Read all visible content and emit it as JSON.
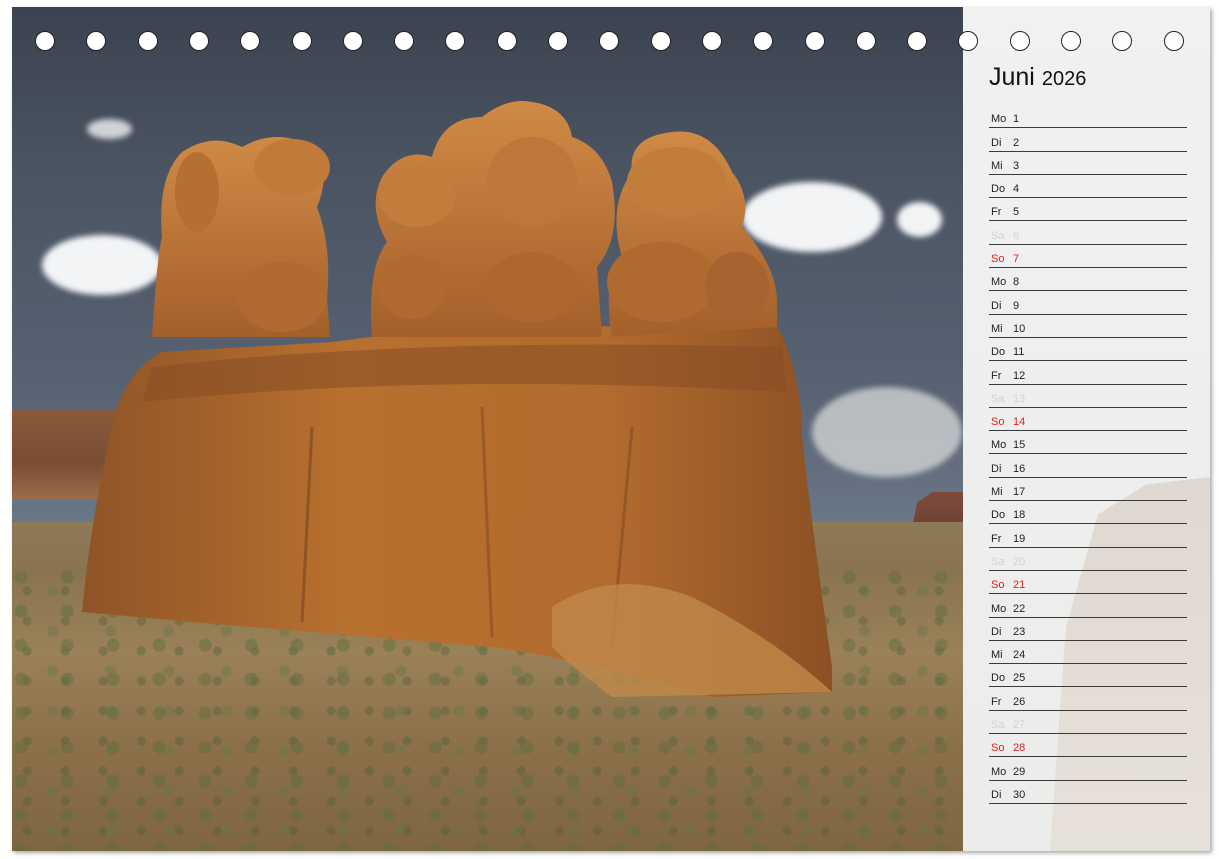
{
  "calendar": {
    "month": "Juni",
    "year": "2026",
    "days": [
      {
        "wd": "Mo",
        "d": "1",
        "type": "weekday"
      },
      {
        "wd": "Di",
        "d": "2",
        "type": "weekday"
      },
      {
        "wd": "Mi",
        "d": "3",
        "type": "weekday"
      },
      {
        "wd": "Do",
        "d": "4",
        "type": "weekday"
      },
      {
        "wd": "Fr",
        "d": "5",
        "type": "weekday"
      },
      {
        "wd": "Sa",
        "d": "6",
        "type": "sat"
      },
      {
        "wd": "So",
        "d": "7",
        "type": "sun"
      },
      {
        "wd": "Mo",
        "d": "8",
        "type": "weekday"
      },
      {
        "wd": "Di",
        "d": "9",
        "type": "weekday"
      },
      {
        "wd": "Mi",
        "d": "10",
        "type": "weekday"
      },
      {
        "wd": "Do",
        "d": "11",
        "type": "weekday"
      },
      {
        "wd": "Fr",
        "d": "12",
        "type": "weekday"
      },
      {
        "wd": "Sa",
        "d": "13",
        "type": "sat"
      },
      {
        "wd": "So",
        "d": "14",
        "type": "sun"
      },
      {
        "wd": "Mo",
        "d": "15",
        "type": "weekday"
      },
      {
        "wd": "Di",
        "d": "16",
        "type": "weekday"
      },
      {
        "wd": "Mi",
        "d": "17",
        "type": "weekday"
      },
      {
        "wd": "Do",
        "d": "18",
        "type": "weekday"
      },
      {
        "wd": "Fr",
        "d": "19",
        "type": "weekday"
      },
      {
        "wd": "Sa",
        "d": "20",
        "type": "sat"
      },
      {
        "wd": "So",
        "d": "21",
        "type": "sun"
      },
      {
        "wd": "Mo",
        "d": "22",
        "type": "weekday"
      },
      {
        "wd": "Di",
        "d": "23",
        "type": "weekday"
      },
      {
        "wd": "Mi",
        "d": "24",
        "type": "weekday"
      },
      {
        "wd": "Do",
        "d": "25",
        "type": "weekday"
      },
      {
        "wd": "Fr",
        "d": "26",
        "type": "weekday"
      },
      {
        "wd": "Sa",
        "d": "27",
        "type": "sat"
      },
      {
        "wd": "So",
        "d": "28",
        "type": "sun"
      },
      {
        "wd": "Mo",
        "d": "29",
        "type": "weekday"
      },
      {
        "wd": "Di",
        "d": "30",
        "type": "weekday"
      }
    ]
  },
  "colors": {
    "sunday": "#e02020",
    "saturday": "#d2d2d2",
    "rock": "#b0652c"
  }
}
